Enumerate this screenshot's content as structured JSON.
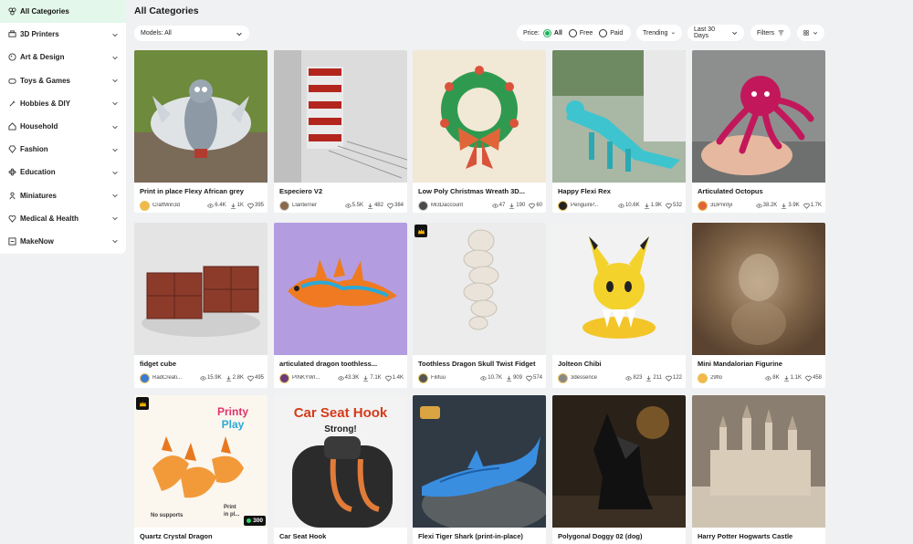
{
  "sidebar": {
    "items": [
      {
        "label": "All Categories",
        "icon": "grid-icon"
      },
      {
        "label": "3D Printers",
        "icon": "printer-icon"
      },
      {
        "label": "Art & Design",
        "icon": "palette-icon"
      },
      {
        "label": "Toys & Games",
        "icon": "gamepad-icon"
      },
      {
        "label": "Hobbies & DIY",
        "icon": "brush-icon"
      },
      {
        "label": "Household",
        "icon": "home-icon"
      },
      {
        "label": "Fashion",
        "icon": "diamond-icon"
      },
      {
        "label": "Education",
        "icon": "atom-icon"
      },
      {
        "label": "Miniatures",
        "icon": "figure-icon"
      },
      {
        "label": "Medical & Health",
        "icon": "health-icon"
      },
      {
        "label": "MakeNow",
        "icon": "makenow-icon"
      }
    ]
  },
  "header": {
    "title": "All Categories",
    "models_select": "Models: All",
    "price_label": "Price:",
    "price_options": [
      "All",
      "Free",
      "Paid"
    ],
    "trending": "Trending",
    "period": "Last 30 Days",
    "filters": "Filters"
  },
  "colors": {
    "accent": "#1cb35a",
    "active_bg": "#e3f8ea"
  },
  "cards": [
    {
      "title": "Print in place Flexy African grey",
      "author": "CraftWin3d",
      "views": "6.4K",
      "downloads": "1K",
      "likes": "395"
    },
    {
      "title": "Especiero V2",
      "author": "Llanterner",
      "views": "5.5K",
      "downloads": "482",
      "likes": "384"
    },
    {
      "title": "Low Poly Christmas Wreath 3D...",
      "author": "Mi3Daccount",
      "views": "47",
      "downloads": "190",
      "likes": "60"
    },
    {
      "title": "Happy Flexi Rex",
      "author": "PenguinP...",
      "views": "10.6K",
      "downloads": "1.9K",
      "likes": "532"
    },
    {
      "title": "Articulated Octopus",
      "author": "3DPrintyi",
      "views": "38.2K",
      "downloads": "3.9K",
      "likes": "1.7K"
    },
    {
      "title": "fidget cube",
      "author": "RadCreati...",
      "views": "15.9K",
      "downloads": "2.8K",
      "likes": "495"
    },
    {
      "title": "articulated dragon toothless...",
      "author": "PINKYWI...",
      "views": "43.3K",
      "downloads": "7.1K",
      "likes": "1.4K"
    },
    {
      "title": "Toothless Dragon Skull Twist Fidget",
      "author": "Filifuu",
      "views": "10.7K",
      "downloads": "909",
      "likes": "574"
    },
    {
      "title": "Jolteon Chibi",
      "author": "3dessence",
      "views": "823",
      "downloads": "211",
      "likes": "122"
    },
    {
      "title": "Mini Mandalorian Figurine",
      "author": "29flo",
      "views": "8K",
      "downloads": "1.1K",
      "likes": "458"
    },
    {
      "title": "Quartz Crystal Dragon",
      "author": "",
      "views": "",
      "downloads": "",
      "likes": "",
      "count_badge": "300",
      "thumb_text": [
        "Printy",
        "Play",
        "No supports",
        "Print",
        "in pl..."
      ]
    },
    {
      "title": "Car Seat Hook",
      "author": "",
      "views": "",
      "downloads": "",
      "likes": "",
      "thumb_text": [
        "Car Seat Hook",
        "Strong!"
      ]
    },
    {
      "title": "Flexi Tiger Shark (print-in-place)",
      "author": "",
      "views": "",
      "downloads": "",
      "likes": ""
    },
    {
      "title": "Polygonal Doggy 02 (dog)",
      "author": "",
      "views": "",
      "downloads": "",
      "likes": ""
    },
    {
      "title": "Harry Potter Hogwarts Castle",
      "author": "",
      "views": "",
      "downloads": "",
      "likes": ""
    }
  ]
}
